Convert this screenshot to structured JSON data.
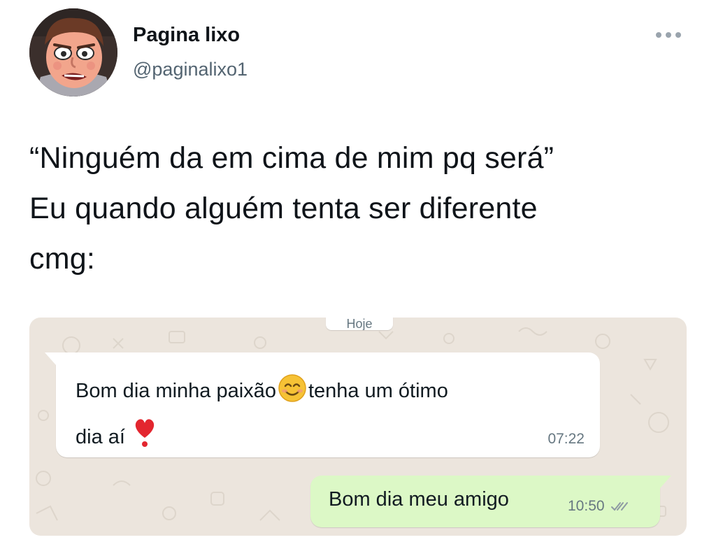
{
  "account": {
    "name": "Pagina lixo",
    "handle": "@paginalixo1"
  },
  "tweet": {
    "lines": [
      "“Ninguém da em cima de mim pq será”",
      "Eu quando alguém tenta ser diferente",
      "cmg:"
    ]
  },
  "chat": {
    "date_label": "Hoje",
    "incoming": {
      "line1_part1": "Bom dia minha paixão",
      "line1_part2": "tenha um ótimo",
      "line2": "dia aí",
      "time": "07:22",
      "emojis": [
        "smiling-face-emoji",
        "heart-exclamation-emoji"
      ]
    },
    "outgoing": {
      "text": "Bom dia meu amigo",
      "time": "10:50",
      "status": "double-check-icon"
    }
  },
  "colors": {
    "chat_background": "#ece5dd",
    "incoming_bubble": "#ffffff",
    "outgoing_bubble": "#dcf8c6",
    "handle_text": "#536471"
  }
}
